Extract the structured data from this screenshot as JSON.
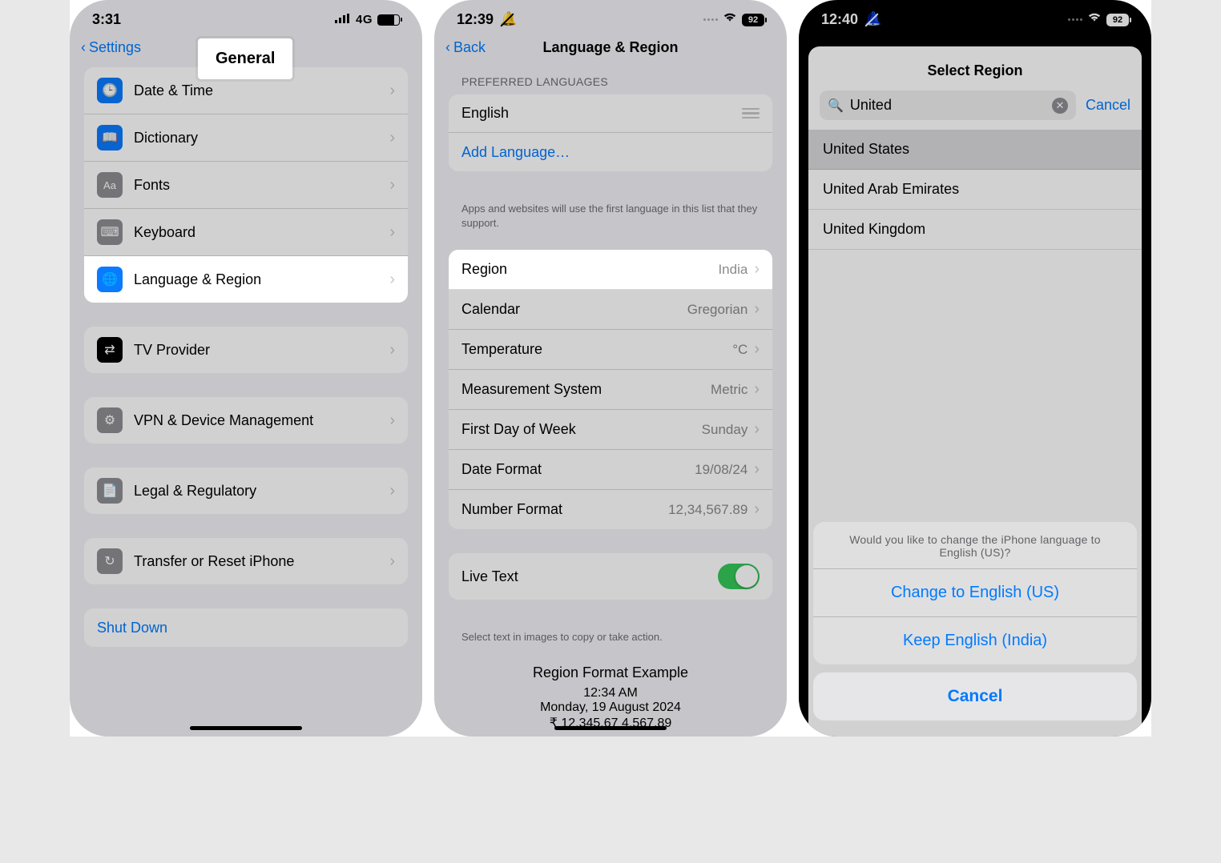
{
  "p1": {
    "time": "3:31",
    "net": "4G",
    "back": "Settings",
    "title_badge": "General",
    "rows1": [
      {
        "name": "date-time",
        "label": "Date & Time",
        "icon": "ic-blue",
        "glyph": "🕒"
      },
      {
        "name": "dictionary",
        "label": "Dictionary",
        "icon": "ic-blue",
        "glyph": "📖"
      },
      {
        "name": "fonts",
        "label": "Fonts",
        "icon": "ic-gray",
        "glyph": "Aa"
      },
      {
        "name": "keyboard",
        "label": "Keyboard",
        "icon": "ic-gray",
        "glyph": "⌨"
      },
      {
        "name": "language-region",
        "label": "Language & Region",
        "icon": "ic-blue",
        "glyph": "🌐",
        "highlight": true
      }
    ],
    "rows2": [
      {
        "name": "tv-provider",
        "label": "TV Provider",
        "icon": "ic-black",
        "glyph": "⇄"
      }
    ],
    "rows3": [
      {
        "name": "vpn-device",
        "label": "VPN & Device Management",
        "icon": "ic-gray",
        "glyph": "⚙"
      }
    ],
    "rows4": [
      {
        "name": "legal",
        "label": "Legal & Regulatory",
        "icon": "ic-gray",
        "glyph": "📄"
      }
    ],
    "rows5": [
      {
        "name": "transfer-reset",
        "label": "Transfer or Reset iPhone",
        "icon": "ic-gray",
        "glyph": "↻"
      }
    ],
    "shutdown": "Shut Down"
  },
  "p2": {
    "time": "12:39",
    "batt": "92",
    "back": "Back",
    "title": "Language & Region",
    "pref_header": "PREFERRED LANGUAGES",
    "english": "English",
    "add_lang": "Add Language…",
    "pref_footer": "Apps and websites will use the first language in this list that they support.",
    "rows": [
      {
        "name": "region",
        "label": "Region",
        "val": "India",
        "highlight": true
      },
      {
        "name": "calendar",
        "label": "Calendar",
        "val": "Gregorian"
      },
      {
        "name": "temperature",
        "label": "Temperature",
        "val": "°C"
      },
      {
        "name": "measurement",
        "label": "Measurement System",
        "val": "Metric"
      },
      {
        "name": "first-day",
        "label": "First Day of Week",
        "val": "Sunday"
      },
      {
        "name": "date-format",
        "label": "Date Format",
        "val": "19/08/24"
      },
      {
        "name": "number-format",
        "label": "Number Format",
        "val": "12,34,567.89"
      }
    ],
    "live_text": "Live Text",
    "live_footer": "Select text in images to copy or take action.",
    "example_title": "Region Format Example",
    "example_time": "12:34 AM",
    "example_date": "Monday, 19 August 2024",
    "example_nums": "₹ 12,345.67   4,567.89"
  },
  "p3": {
    "time": "12:40",
    "batt": "92",
    "title": "Select Region",
    "query": "United",
    "cancel": "Cancel",
    "results": [
      {
        "name": "united-states",
        "label": "United States",
        "sel": true
      },
      {
        "name": "uae",
        "label": "United Arab Emirates"
      },
      {
        "name": "uk",
        "label": "United Kingdom"
      }
    ],
    "alert_msg": "Would you like to change the iPhone language to English (US)?",
    "alert_change": "Change to English (US)",
    "alert_keep": "Keep English (India)",
    "alert_cancel": "Cancel"
  }
}
